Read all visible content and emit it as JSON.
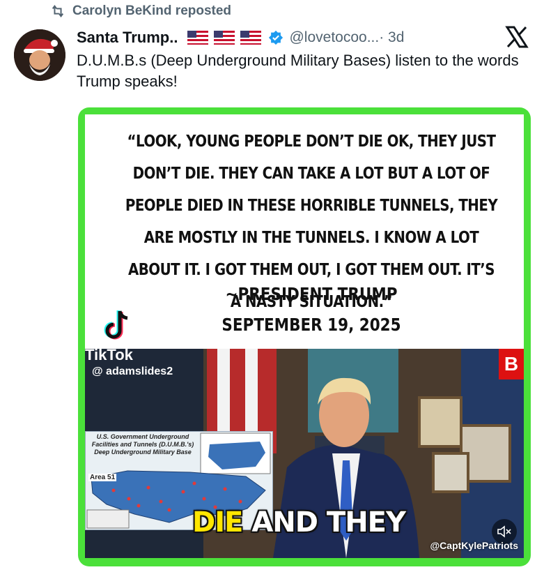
{
  "repost": {
    "label": "Carolyn BeKind reposted"
  },
  "author": {
    "name": "Santa Trump..",
    "handle": "@lovetocoo...",
    "time": "· 3d"
  },
  "post": {
    "text": "D.U.M.B.s (Deep Underground Military Bases) listen to the words Trump speaks!"
  },
  "media": {
    "quote": "“LOOK, YOUNG PEOPLE DON’T DIE OK, THEY JUST DON’T DIE. THEY CAN TAKE A LOT BUT A LOT OF PEOPLE DIED IN THESE HORRIBLE TUNNELS, THEY ARE MOSTLY IN THE TUNNELS. I KNOW A LOT ABOUT IT. I GOT THEM OUT, I GOT THEM OUT. IT’S A NASTY SITUATION.”",
    "attribution": "~PRESIDENT TRUMP",
    "date": "SEPTEMBER 19, 2025",
    "tiktok_watermark": "TikTok",
    "tiktok_user": "@ adamslides2",
    "map_title": "U.S. Government Underground Facilities and Tunnels (D.U.M.B.'s) Deep Underground Military Base",
    "map_label": "Area 51",
    "caption_highlight": "DIE",
    "caption_rest": " AND THEY",
    "credit": "@CaptKylePatriots",
    "channel_logo": "B"
  },
  "colors": {
    "media_border": "#4be03a",
    "secondary_text": "#536471",
    "verified": "#1d9bf0"
  },
  "icons": [
    "repost-icon",
    "verified-badge-icon",
    "x-logo-icon",
    "tiktok-icon",
    "mute-icon",
    "us-flag-icon"
  ]
}
